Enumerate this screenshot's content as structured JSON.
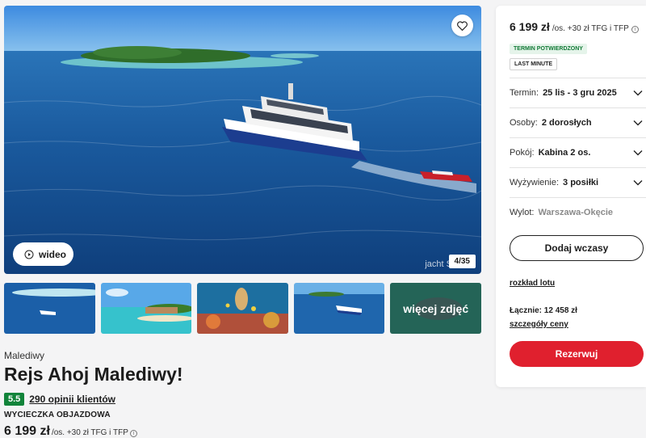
{
  "gallery": {
    "video_label": "wideo",
    "counter": "4/35",
    "watermark": "jacht S",
    "more_photos_label": "więcej zdjęć",
    "thumbnails": [
      "boat-sandbank",
      "island-resort",
      "snorkeling-reef",
      "boat-island",
      "more-photos"
    ]
  },
  "trip": {
    "region": "Malediwy",
    "title": "Rejs Ahoj Malediwy!",
    "rating": "5.5",
    "reviews": "290 opinii klientów",
    "type": "WYCIECZKA OBJAZDOWA",
    "price": "6 199 zł",
    "price_suffix": "/os. +30 zł TFG i TFP"
  },
  "panel": {
    "price": "6 199 zł",
    "price_suffix": "/os. +30 zł TFG i TFP",
    "tag_confirmed": "TERMIN POTWIERDZONY",
    "tag_last_minute": "LAST MINUTE",
    "options": [
      {
        "label": "Termin:",
        "value": "25 lis - 3 gru 2025"
      },
      {
        "label": "Osoby:",
        "value": "2 dorosłych"
      },
      {
        "label": "Pokój:",
        "value": "Kabina 2 os."
      },
      {
        "label": "Wyżywienie:",
        "value": "3 posiłki"
      },
      {
        "label": "Wylot:",
        "value": "Warszawa-Okęcie"
      }
    ],
    "add_button": "Dodaj wczasy",
    "flight_link": "rozkład lotu",
    "total": "Łącznie: 12 458 zł",
    "details_link": "szczegóły ceny",
    "book_button": "Rezerwuj"
  },
  "colors": {
    "accent_red": "#e0202e",
    "rating_green": "#12843a",
    "confirmed_bg": "#e5f4ea"
  }
}
